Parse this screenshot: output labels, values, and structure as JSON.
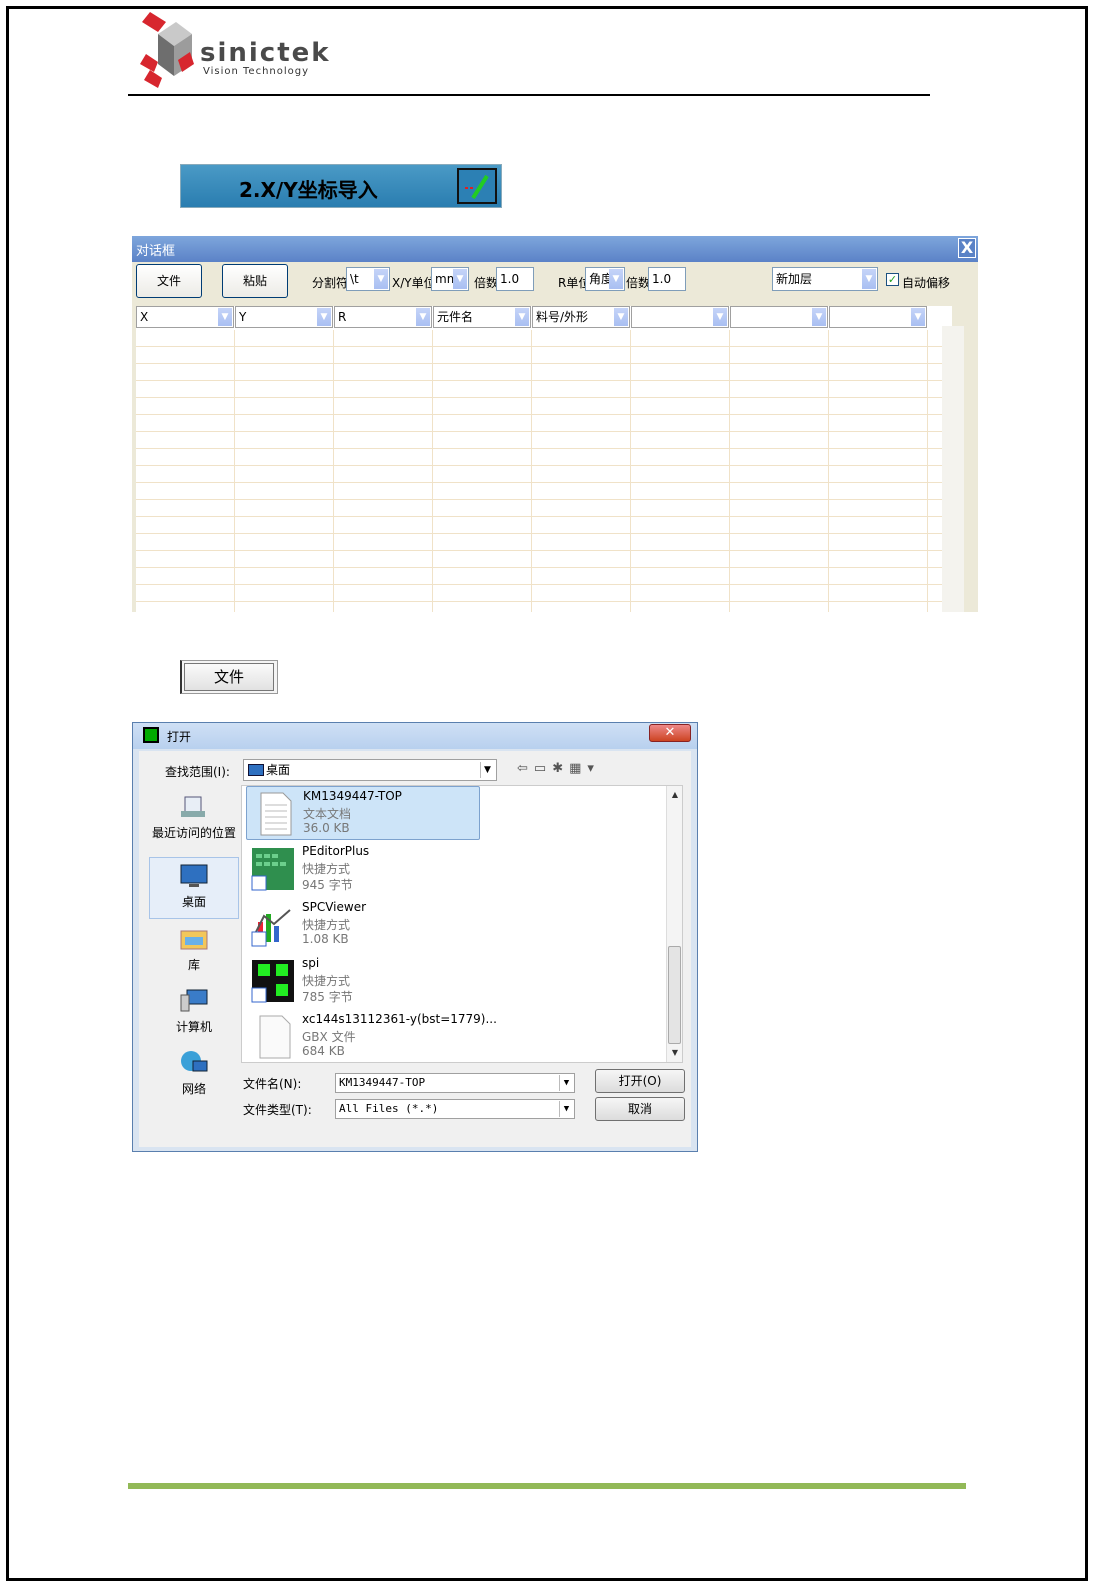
{
  "header": {
    "logo_name": "sinictek",
    "logo_tagline": "Vision Technology"
  },
  "section": {
    "banner_title": "2.X/Y坐标导入",
    "banner_icon": "import-xy-icon"
  },
  "import_dialog": {
    "title": "对话框",
    "close_label": "X",
    "file_button": "文件",
    "paste_button": "粘贴",
    "separator_label": "分割符",
    "separator_value": "\\t",
    "xy_unit_label": "X/Y单位",
    "xy_unit_value": "mm",
    "xy_factor_label": "倍数",
    "xy_factor_value": "1.0",
    "r_unit_label": "R单位",
    "r_unit_value": "角度",
    "r_factor_label": "倍数",
    "r_factor_value": "1.0",
    "layer_value": "新加层",
    "auto_offset_label": "自动偏移",
    "auto_offset_checked": true,
    "columns": [
      "X",
      "Y",
      "R",
      "元件名",
      "料号/外形",
      "",
      "",
      ""
    ]
  },
  "file_button_example": {
    "label": "文件"
  },
  "open_dialog": {
    "title": "打开",
    "close_label": "✕",
    "look_in_label": "查找范围(I):",
    "look_in_value": "桌面",
    "places": [
      {
        "label": "最近访问的位置",
        "icon": "recent-places-icon"
      },
      {
        "label": "桌面",
        "icon": "desktop-icon"
      },
      {
        "label": "库",
        "icon": "libraries-icon"
      },
      {
        "label": "计算机",
        "icon": "computer-icon"
      },
      {
        "label": "网络",
        "icon": "network-icon"
      }
    ],
    "files": [
      {
        "name": "KM1349447-TOP",
        "type": "文本文档",
        "size": "36.0 KB",
        "icon": "text-document-icon"
      },
      {
        "name": "PEditorPlus",
        "type": "快捷方式",
        "size": "945 字节",
        "icon": "peditorplus-shortcut-icon"
      },
      {
        "name": "SPCViewer",
        "type": "快捷方式",
        "size": "1.08 KB",
        "icon": "spcviewer-shortcut-icon"
      },
      {
        "name": "spi",
        "type": "快捷方式",
        "size": "785 字节",
        "icon": "spi-shortcut-icon"
      },
      {
        "name": "xc144s13112361-y(bst=1779)...",
        "type": "GBX 文件",
        "size": "684 KB",
        "icon": "blank-file-icon"
      }
    ],
    "filename_label": "文件名(N):",
    "filename_value": "KM1349447-TOP",
    "filetype_label": "文件类型(T):",
    "filetype_value": "All Files (*.*)",
    "open_button": "打开(O)",
    "cancel_button": "取消"
  }
}
